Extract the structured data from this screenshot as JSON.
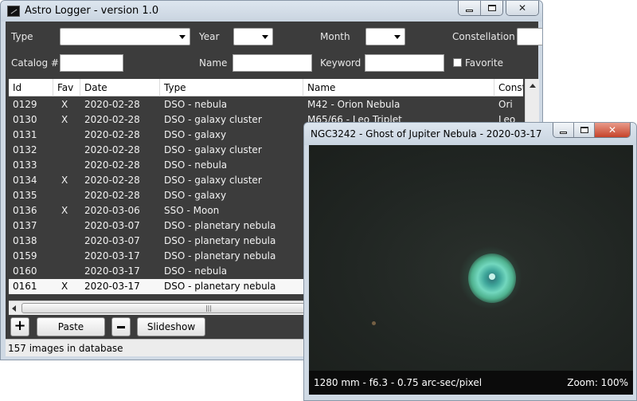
{
  "main_window": {
    "title": "Astro Logger - version 1.0",
    "controls": {
      "minimize": "",
      "maximize": "",
      "close": "✕"
    }
  },
  "filters": {
    "type_label": "Type",
    "type_value": "",
    "year_label": "Year",
    "year_value": "",
    "month_label": "Month",
    "month_value": "",
    "constellation_label": "Constellation",
    "constellation_value": "",
    "catalog_label": "Catalog #",
    "catalog_value": "",
    "name_label": "Name",
    "name_value": "",
    "keyword_label": "Keyword",
    "keyword_value": "",
    "favorite_label": "Favorite",
    "favorite_checked": false
  },
  "table": {
    "columns": [
      "Id",
      "Fav",
      "Date",
      "Type",
      "Name",
      "Const"
    ],
    "rows": [
      {
        "id": "0129",
        "fav": "X",
        "date": "2020-02-28",
        "type": "DSO - nebula",
        "name": "M42 - Orion Nebula",
        "const": "Ori"
      },
      {
        "id": "0130",
        "fav": "X",
        "date": "2020-02-28",
        "type": "DSO - galaxy cluster",
        "name": "M65/66 - Leo Triplet",
        "const": "Leo"
      },
      {
        "id": "0131",
        "fav": "",
        "date": "2020-02-28",
        "type": "DSO - galaxy",
        "name": "",
        "const": ""
      },
      {
        "id": "0132",
        "fav": "",
        "date": "2020-02-28",
        "type": "DSO - galaxy cluster",
        "name": "",
        "const": ""
      },
      {
        "id": "0133",
        "fav": "",
        "date": "2020-02-28",
        "type": "DSO - nebula",
        "name": "",
        "const": ""
      },
      {
        "id": "0134",
        "fav": "X",
        "date": "2020-02-28",
        "type": "DSO - galaxy cluster",
        "name": "",
        "const": ""
      },
      {
        "id": "0135",
        "fav": "",
        "date": "2020-02-28",
        "type": "DSO - galaxy",
        "name": "",
        "const": ""
      },
      {
        "id": "0136",
        "fav": "X",
        "date": "2020-03-06",
        "type": "SSO - Moon",
        "name": "",
        "const": ""
      },
      {
        "id": "0137",
        "fav": "",
        "date": "2020-03-07",
        "type": "DSO - planetary nebula",
        "name": "",
        "const": ""
      },
      {
        "id": "0138",
        "fav": "",
        "date": "2020-03-07",
        "type": "DSO - planetary nebula",
        "name": "",
        "const": ""
      },
      {
        "id": "0159",
        "fav": "",
        "date": "2020-03-17",
        "type": "DSO - planetary nebula",
        "name": "",
        "const": ""
      },
      {
        "id": "0160",
        "fav": "",
        "date": "2020-03-17",
        "type": "DSO - nebula",
        "name": "",
        "const": ""
      },
      {
        "id": "0161",
        "fav": "X",
        "date": "2020-03-17",
        "type": "DSO - planetary nebula",
        "name": "",
        "const": ""
      }
    ],
    "selected_row_index": 12,
    "hscroll_grip": "|||"
  },
  "toolbar": {
    "add_icon": "+",
    "paste_label": "Paste",
    "slideshow_label": "Slideshow"
  },
  "status": {
    "text": "157 images in database"
  },
  "viewer": {
    "title": "NGC3242 - Ghost of Jupiter Nebula - 2020-03-17",
    "controls": {
      "close": "✕"
    },
    "info_left": "1280 mm - f6.3 - 0.75 arc-sec/pixel",
    "info_right": "Zoom: 100%"
  },
  "colors": {
    "dark_background": "#3c3c3c",
    "selected_row": "#f7f7f7",
    "close_button": "#c6432a"
  }
}
